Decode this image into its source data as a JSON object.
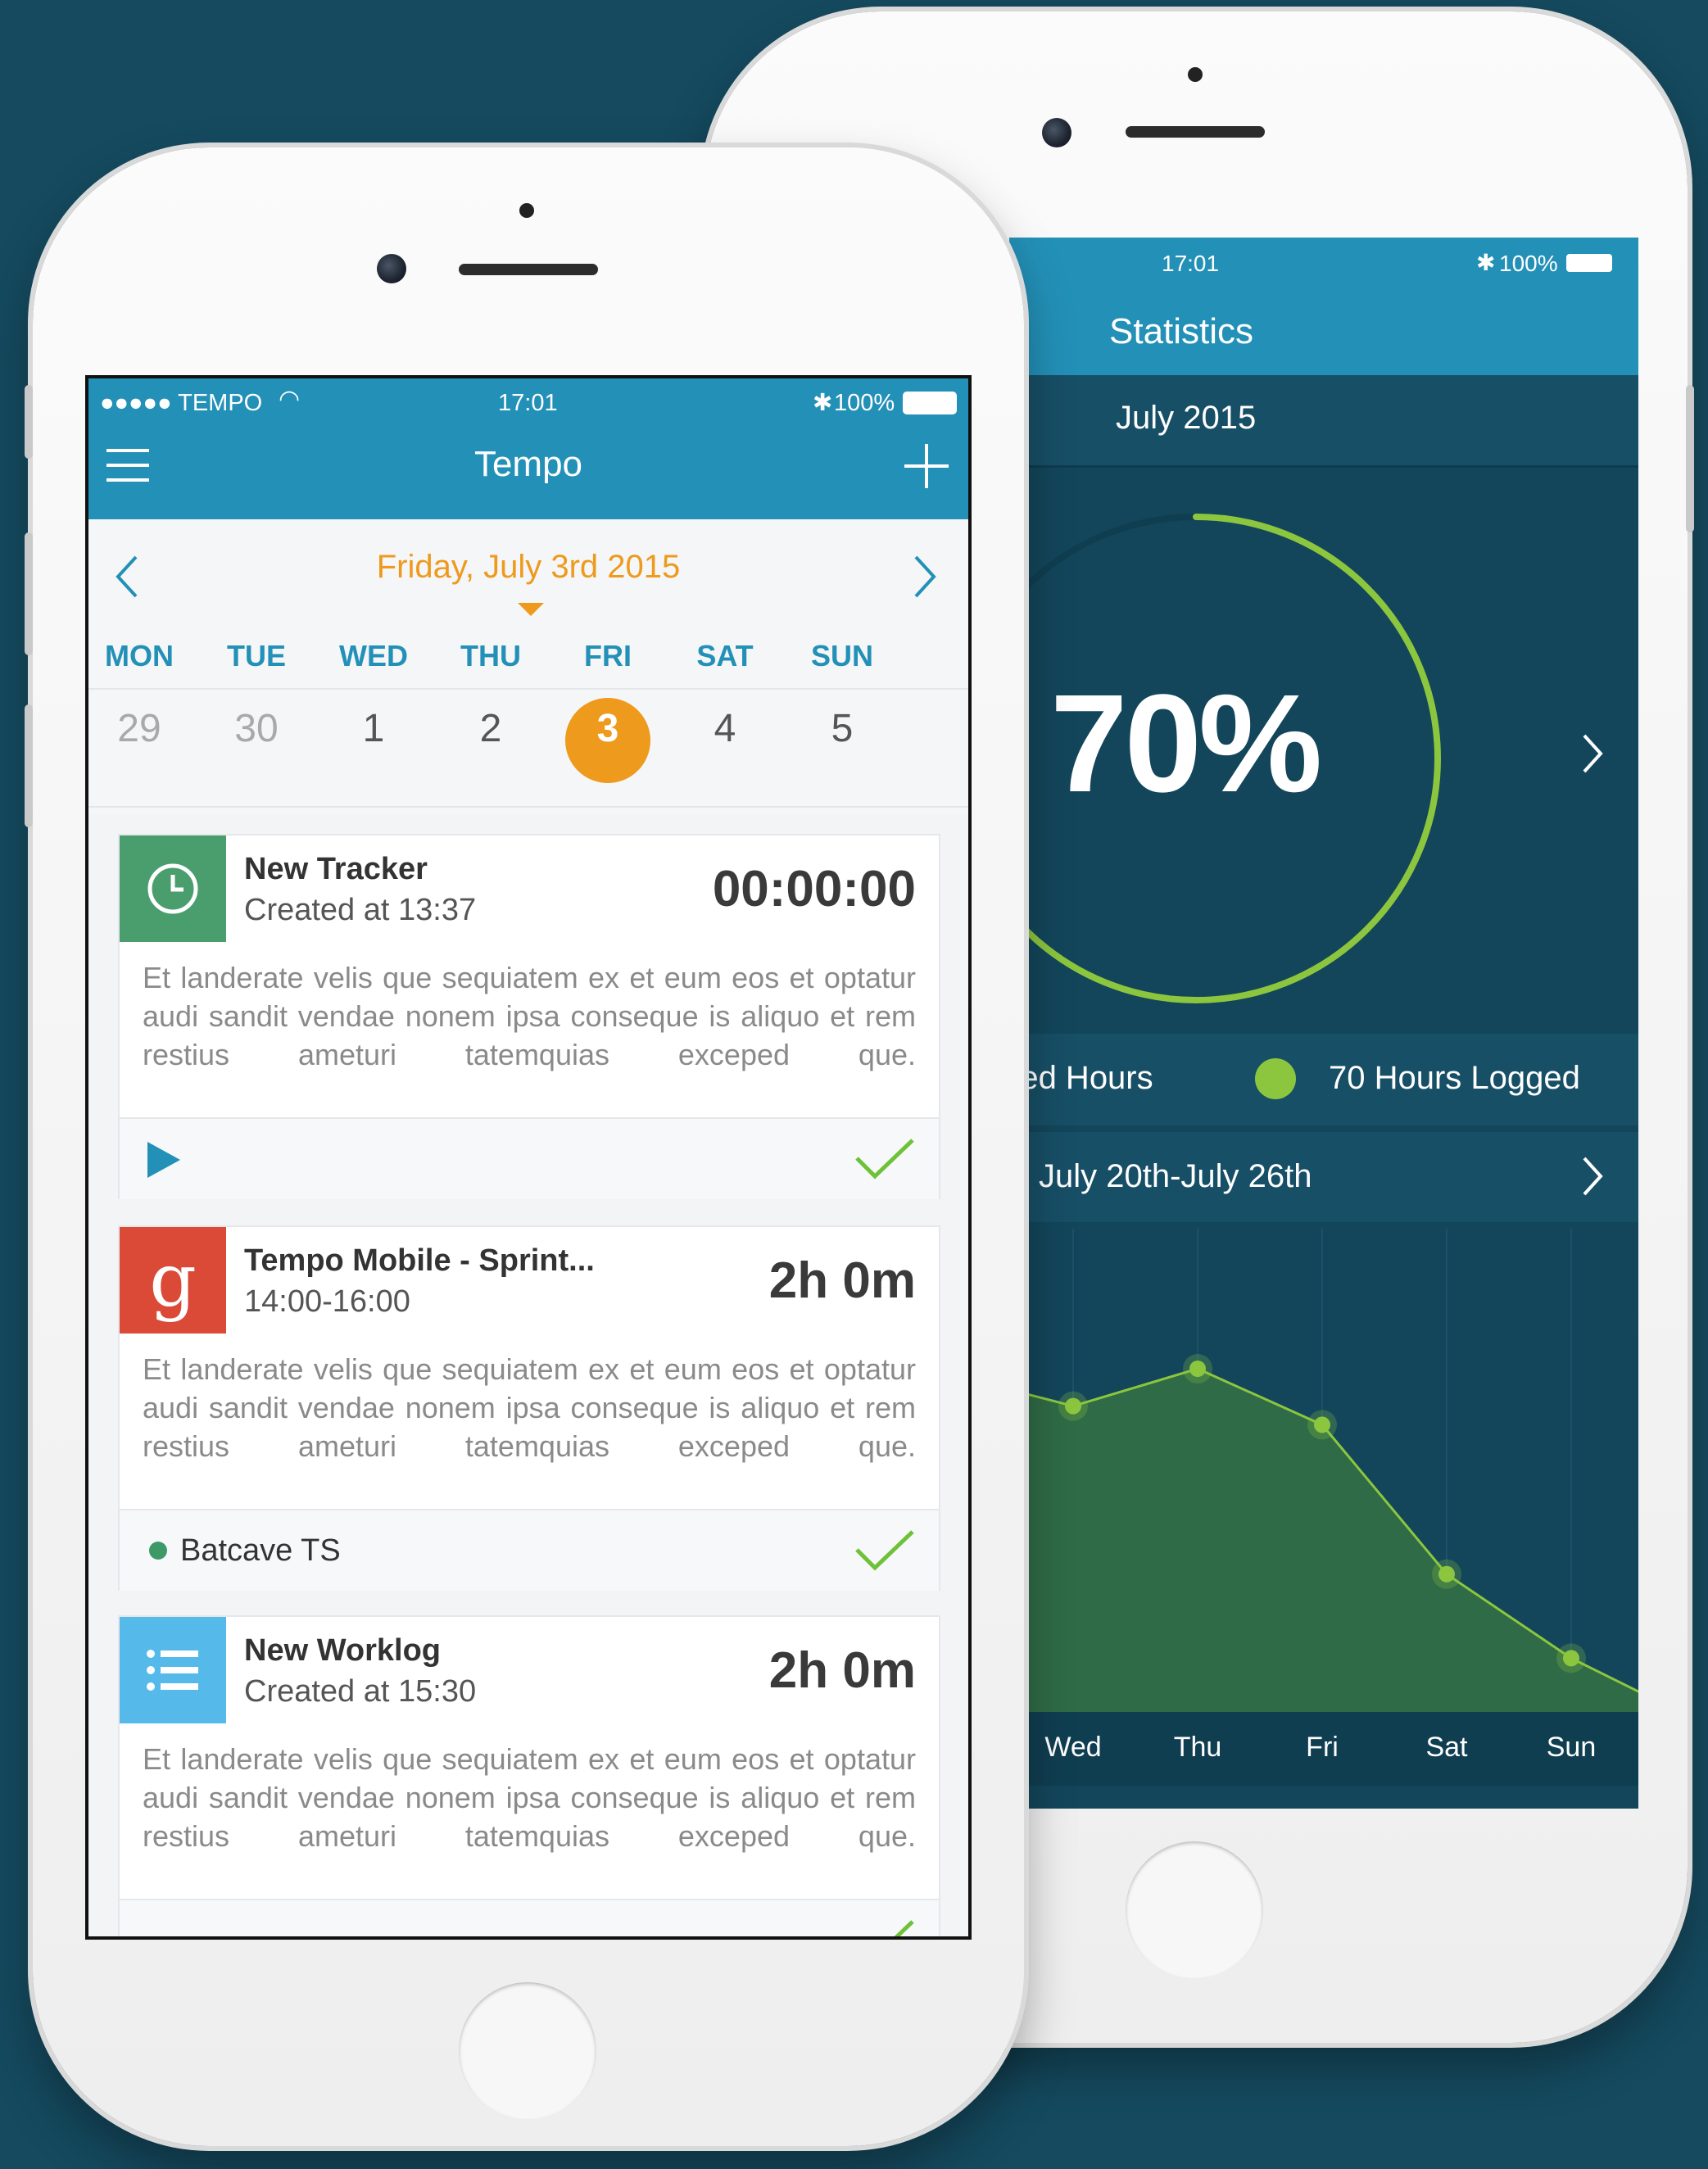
{
  "stats_phone": {
    "status": {
      "time": "17:01",
      "battery": "100%"
    },
    "nav_title": "Statistics",
    "month": "July 2015",
    "percent": "70%",
    "progress_fraction": 0.7,
    "legend": {
      "required_label": "red Hours",
      "logged_label": "70 Hours Logged"
    },
    "week_range": "July 20th-July 26th",
    "chart_data": {
      "type": "area",
      "x": [
        "Wed",
        "Thu",
        "Fri",
        "Sat",
        "Sun"
      ],
      "series": [
        {
          "values": [
            6.2,
            7.0,
            5.8,
            2.6,
            0.8
          ]
        }
      ],
      "ylim": [
        0,
        10
      ]
    },
    "colors": {
      "accent_green": "#8cc63e",
      "header_blue": "#2390b7",
      "bg_dark": "#13465b"
    }
  },
  "tempo_phone": {
    "status": {
      "carrier": "●●●●● TEMPO",
      "time": "17:01",
      "battery": "100%"
    },
    "nav_title": "Tempo",
    "date": "Friday, July 3rd 2015",
    "weekdays": [
      "MON",
      "TUE",
      "WED",
      "THU",
      "FRI",
      "SAT",
      "SUN"
    ],
    "days": [
      "29",
      "30",
      "1",
      "2",
      "3",
      "4",
      "5"
    ],
    "selected_day": "3",
    "cards": [
      {
        "icon": "clock-icon",
        "title": "New Tracker",
        "subtitle": "Created at 13:37",
        "time": "00:00:00",
        "body": "Et landerate velis que sequiatem ex et eum eos et optatur audi sandit vendae nonem ipsa conseque is aliquo et rem restius ameturi tatemquias exceped que.",
        "footer_label": ""
      },
      {
        "icon": "google-icon",
        "title": "Tempo Mobile - Sprint...",
        "subtitle": "14:00-16:00",
        "time": "2h 0m",
        "body": "Et landerate velis que sequiatem ex et eum eos et optatur audi sandit vendae nonem ipsa conseque is aliquo et rem restius ameturi tatemquias exceped que.",
        "footer_label": "Batcave TS"
      },
      {
        "icon": "list-icon",
        "title": "New Worklog",
        "subtitle": "Created at 15:30",
        "time": "2h 0m",
        "body": "Et landerate velis que sequiatem ex et eum eos et optatur audi sandit vendae nonem ipsa conseque is aliquo et rem restius ameturi tatemquias exceped que.",
        "footer_label": ""
      }
    ],
    "colors": {
      "accent_orange": "#ee9a1c",
      "green": "#4a9e6e",
      "red": "#db4a37",
      "light_blue": "#55b9e9",
      "check_green": "#6fc13a"
    }
  }
}
